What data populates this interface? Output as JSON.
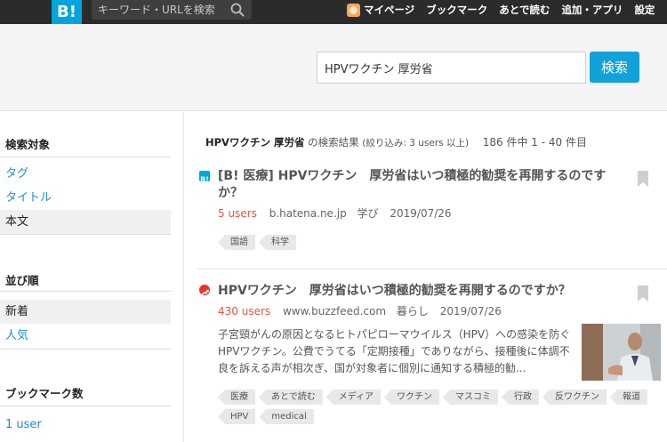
{
  "topbar": {
    "logo_text": "B!",
    "search_placeholder": "キーワード・URLを検索",
    "nav": {
      "mypage": "マイページ",
      "bookmarks": "ブックマーク",
      "read_later": "あとで読む",
      "add_app": "追加・アプリ",
      "settings": "設定"
    }
  },
  "search": {
    "query": "HPVワクチン 厚労省",
    "button_label": "検索"
  },
  "sidebar": {
    "target_heading": "検索対象",
    "target_items": [
      {
        "label": "タグ"
      },
      {
        "label": "タイトル"
      },
      {
        "label": "本文"
      }
    ],
    "sort_heading": "並び順",
    "sort_items": [
      {
        "label": "新着"
      },
      {
        "label": "人気"
      }
    ],
    "bookmark_count_heading": "ブックマーク数",
    "bookmark_count_items": [
      {
        "label": "1 user"
      }
    ]
  },
  "results": {
    "query": "HPVワクチン 厚労省",
    "suffix": "の検索結果",
    "filter": "(絞り込み: 3 users 以上)",
    "count": "186 件中 1 - 40 件目",
    "entries": [
      {
        "title": "[B! 医療] HPVワクチン　厚労省はいつ積極的勧奨を再開するのですか？",
        "users": "5 users",
        "domain": "b.hatena.ne.jp",
        "category": "学び",
        "date": "2019/07/26",
        "tags": [
          "国語",
          "科学"
        ],
        "favicon": "hatena-favicon-icon"
      },
      {
        "title": "HPVワクチン　厚労省はいつ積極的勧奨を再開するのですか？",
        "users": "430 users",
        "domain": "www.buzzfeed.com",
        "category": "暮らし",
        "date": "2019/07/26",
        "summary": "子宮頸がんの原因となるヒトパピローマウイルス（HPV）への感染を防ぐHPVワクチン。公費でうてる「定期接種」でありながら、接種後に体調不良を訴える声が相次ぎ、国が対象者に個別に通知する積極的勧...",
        "tags": [
          "医療",
          "あとで読む",
          "メディア",
          "ワクチン",
          "マスコミ",
          "行政",
          "反ワクチン",
          "報道",
          "HPV",
          "medical"
        ],
        "favicon": "buzzfeed-favicon-icon"
      }
    ]
  },
  "colors": {
    "brand": "#00a4de",
    "topbar_bg": "#2b2b2b",
    "link": "#1c8fcf",
    "users": "#e8553e",
    "buzzfeed_icon": "#ee3322"
  }
}
